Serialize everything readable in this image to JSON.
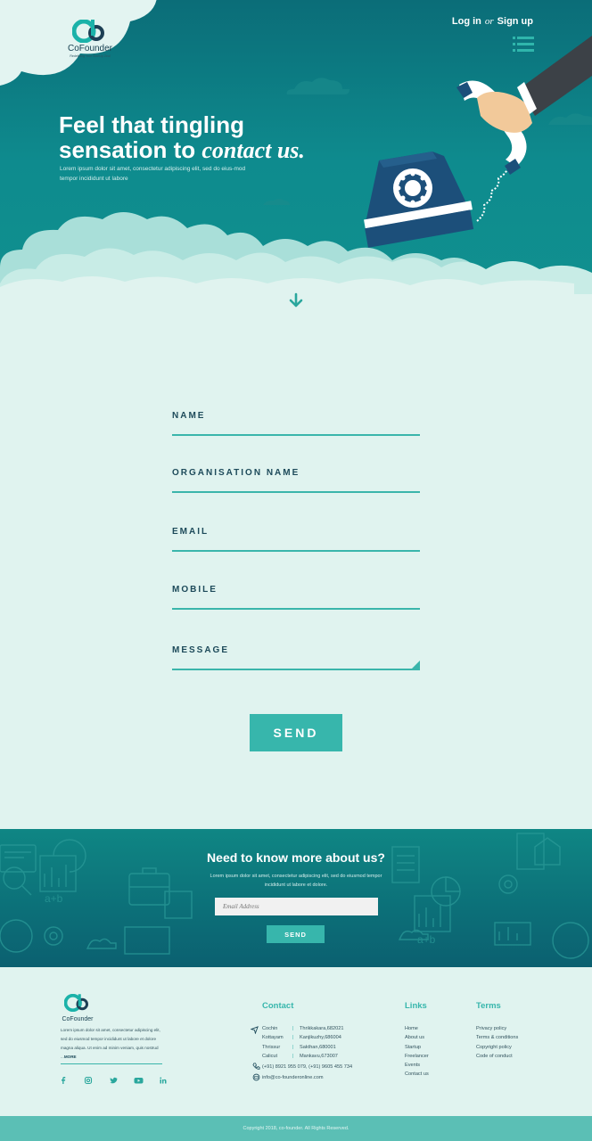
{
  "brand": {
    "name": "CoFounder",
    "tagline": "Redefining Your StartUp Zeal"
  },
  "auth": {
    "login": "Log in",
    "or": "or",
    "signup": "Sign up"
  },
  "hero": {
    "title_line1": "Feel that tingling",
    "title_line2_prefix": "sensation to ",
    "title_line2_accent": "contact us.",
    "description": "Lorem ipsum dolor sit amet, consectetur adipiscing elit, sed do eius-mod tempor incididunt ut labore"
  },
  "form": {
    "fields": [
      {
        "label": "NAME"
      },
      {
        "label": "ORGANISATION NAME"
      },
      {
        "label": "EMAIL"
      },
      {
        "label": "MOBILE"
      },
      {
        "label": "MESSAGE"
      }
    ],
    "send_label": "SEND"
  },
  "newsletter": {
    "title": "Need to know more about us?",
    "description": "Lorem ipsum dolor sit amet, consectetur adipiscing elit, sed do eiusmod tempor incididunt ut labore et dolore.",
    "email_placeholder": "Email Address",
    "send_label": "SEND"
  },
  "footer": {
    "brand": "CoFounder",
    "about": "Lorem ipsum dolor sit amet, consectetur adipiscing elit, sed do eiusmod tempor incididunt ut labore et dolore magna aliqua. Ut enim ad minim veniam, quis nostrud ...",
    "more": "MORE",
    "contact_heading": "Contact",
    "offices": [
      {
        "city": "Cochin",
        "address": "Thrikkakara,682021"
      },
      {
        "city": "Kottayam",
        "address": "Kanjikuzhy,686004"
      },
      {
        "city": "Thrissur",
        "address": "Sakthan,680001"
      },
      {
        "city": "Calicut",
        "address": "Mankavu,673007"
      }
    ],
    "phone": "(+91) 8921 955 079, (+91) 9605 455 734",
    "email": "info@co-founderonline.com",
    "links_heading": "Links",
    "links": [
      "Home",
      "About us",
      "Startup",
      "Freelancer",
      "Events",
      "Contact us"
    ],
    "terms_heading": "Terms",
    "terms": [
      "Privacy policy",
      "Terms & conditions",
      "Copyright policy",
      "Code of conduct"
    ],
    "social": [
      "facebook-icon",
      "instagram-icon",
      "twitter-icon",
      "youtube-icon",
      "linkedin-icon"
    ],
    "copyright": "Copyright 2018, co-founder. All Rights Reserved."
  },
  "colors": {
    "teal_dark": "#0b6d78",
    "teal": "#10908f",
    "accent": "#37b6ac",
    "navy": "#1d4a5a",
    "background": "#e0f3ef"
  }
}
